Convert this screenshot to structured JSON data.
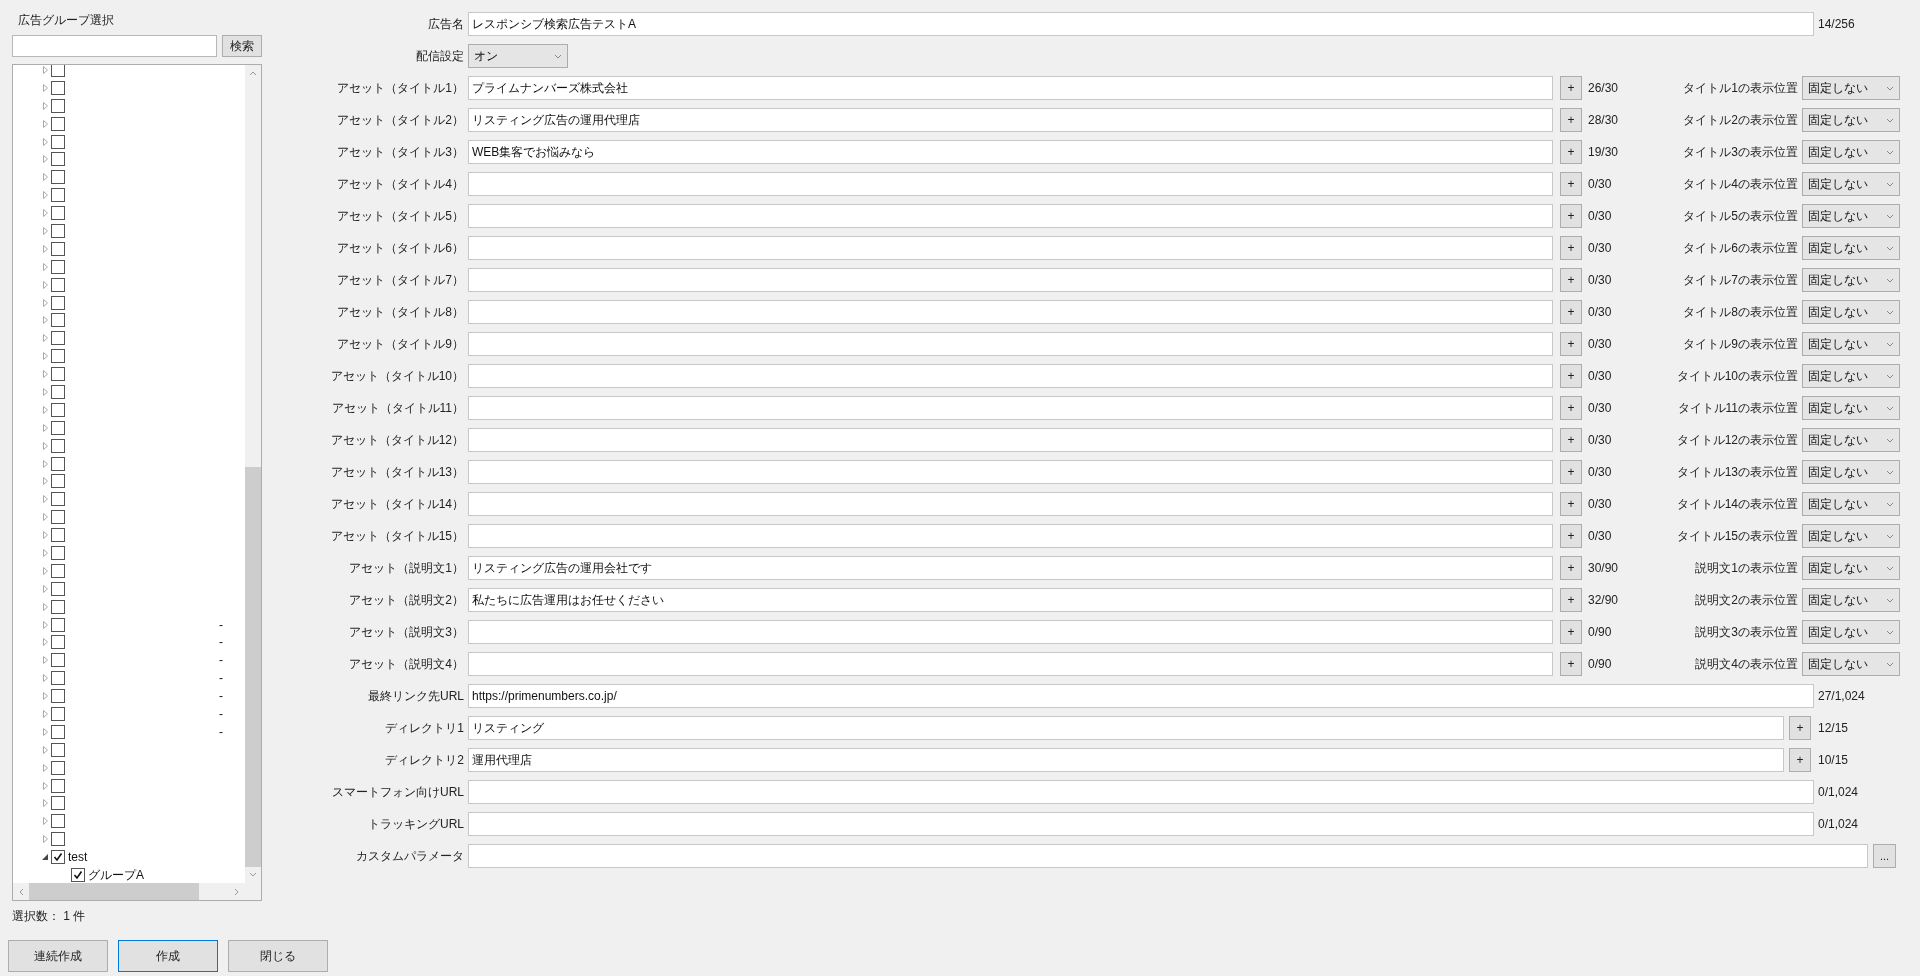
{
  "group_panel": {
    "title": "広告グループ選択",
    "search_button": "検索",
    "tree": [
      {
        "checked": false,
        "expanded": false
      },
      {
        "checked": false,
        "expanded": false
      },
      {
        "checked": false,
        "expanded": false
      },
      {
        "checked": false,
        "expanded": false
      },
      {
        "checked": false,
        "expanded": false
      },
      {
        "checked": false,
        "expanded": false
      },
      {
        "checked": false,
        "expanded": false
      },
      {
        "checked": false,
        "expanded": false
      },
      {
        "checked": false,
        "expanded": false
      },
      {
        "checked": false,
        "expanded": false
      },
      {
        "checked": false,
        "expanded": false
      },
      {
        "checked": false,
        "expanded": false
      },
      {
        "checked": false,
        "expanded": false
      },
      {
        "checked": false,
        "expanded": false
      },
      {
        "checked": false,
        "expanded": false
      },
      {
        "checked": false,
        "expanded": false
      },
      {
        "checked": false,
        "expanded": false
      },
      {
        "checked": false,
        "expanded": false
      },
      {
        "checked": false,
        "expanded": false
      },
      {
        "checked": false,
        "expanded": false
      },
      {
        "checked": false,
        "expanded": false
      },
      {
        "checked": false,
        "expanded": false
      },
      {
        "checked": false,
        "expanded": false
      },
      {
        "checked": false,
        "expanded": false
      },
      {
        "checked": false,
        "expanded": false
      },
      {
        "checked": false,
        "expanded": false
      },
      {
        "checked": false,
        "expanded": false
      },
      {
        "checked": false,
        "expanded": false
      },
      {
        "checked": false,
        "expanded": false
      },
      {
        "checked": false,
        "expanded": false
      },
      {
        "checked": false,
        "expanded": false
      },
      {
        "checked": false,
        "expanded": false,
        "note": "-"
      },
      {
        "checked": false,
        "expanded": false,
        "note": "-"
      },
      {
        "checked": false,
        "expanded": false,
        "note": "-"
      },
      {
        "checked": false,
        "expanded": false,
        "note": "-"
      },
      {
        "checked": false,
        "expanded": false,
        "note": "-"
      },
      {
        "checked": false,
        "expanded": false,
        "note": "-"
      },
      {
        "checked": false,
        "expanded": false,
        "note": "-"
      },
      {
        "checked": false,
        "expanded": false
      },
      {
        "checked": false,
        "expanded": false
      },
      {
        "checked": false,
        "expanded": false
      },
      {
        "checked": false,
        "expanded": false
      },
      {
        "checked": false,
        "expanded": false
      },
      {
        "checked": false,
        "expanded": false
      },
      {
        "label": "test",
        "checked": true,
        "expanded": true,
        "children": [
          {
            "label": "グループA",
            "checked": true
          }
        ]
      }
    ],
    "selection_count": "選択数： 1 件"
  },
  "form": [
    {
      "kind": "text",
      "label": "広告名",
      "value": "レスポンシブ検索広告テストA",
      "count": "14/256"
    },
    {
      "kind": "select",
      "label": "配信設定",
      "value": "オン"
    },
    {
      "kind": "asset",
      "label": "アセット（タイトル1）",
      "value": "プライムナンバーズ株式会社",
      "button": "+",
      "count": "26/30",
      "position_label": "タイトル1の表示位置",
      "position_value": "固定しない"
    },
    {
      "kind": "asset",
      "label": "アセット（タイトル2）",
      "value": "リスティング広告の運用代理店",
      "button": "+",
      "count": "28/30",
      "position_label": "タイトル2の表示位置",
      "position_value": "固定しない"
    },
    {
      "kind": "asset",
      "label": "アセット（タイトル3）",
      "value": "WEB集客でお悩みなら",
      "button": "+",
      "count": "19/30",
      "position_label": "タイトル3の表示位置",
      "position_value": "固定しない"
    },
    {
      "kind": "asset",
      "label": "アセット（タイトル4）",
      "button": "+",
      "count": "0/30",
      "position_label": "タイトル4の表示位置",
      "position_value": "固定しない"
    },
    {
      "kind": "asset",
      "label": "アセット（タイトル5）",
      "button": "+",
      "count": "0/30",
      "position_label": "タイトル5の表示位置",
      "position_value": "固定しない"
    },
    {
      "kind": "asset",
      "label": "アセット（タイトル6）",
      "button": "+",
      "count": "0/30",
      "position_label": "タイトル6の表示位置",
      "position_value": "固定しない"
    },
    {
      "kind": "asset",
      "label": "アセット（タイトル7）",
      "button": "+",
      "count": "0/30",
      "position_label": "タイトル7の表示位置",
      "position_value": "固定しない"
    },
    {
      "kind": "asset",
      "label": "アセット（タイトル8）",
      "button": "+",
      "count": "0/30",
      "position_label": "タイトル8の表示位置",
      "position_value": "固定しない"
    },
    {
      "kind": "asset",
      "label": "アセット（タイトル9）",
      "button": "+",
      "count": "0/30",
      "position_label": "タイトル9の表示位置",
      "position_value": "固定しない"
    },
    {
      "kind": "asset",
      "label": "アセット（タイトル10）",
      "button": "+",
      "count": "0/30",
      "position_label": "タイトル10の表示位置",
      "position_value": "固定しない"
    },
    {
      "kind": "asset",
      "label": "アセット（タイトル11）",
      "button": "+",
      "count": "0/30",
      "position_label": "タイトル11の表示位置",
      "position_value": "固定しない"
    },
    {
      "kind": "asset",
      "label": "アセット（タイトル12）",
      "button": "+",
      "count": "0/30",
      "position_label": "タイトル12の表示位置",
      "position_value": "固定しない"
    },
    {
      "kind": "asset",
      "label": "アセット（タイトル13）",
      "button": "+",
      "count": "0/30",
      "position_label": "タイトル13の表示位置",
      "position_value": "固定しない"
    },
    {
      "kind": "asset",
      "label": "アセット（タイトル14）",
      "button": "+",
      "count": "0/30",
      "position_label": "タイトル14の表示位置",
      "position_value": "固定しない"
    },
    {
      "kind": "asset",
      "label": "アセット（タイトル15）",
      "button": "+",
      "count": "0/30",
      "position_label": "タイトル15の表示位置",
      "position_value": "固定しない"
    },
    {
      "kind": "asset",
      "label": "アセット（説明文1）",
      "value": "リスティング広告の運用会社です",
      "button": "+",
      "count": "30/90",
      "position_label": "説明文1の表示位置",
      "position_value": "固定しない"
    },
    {
      "kind": "asset",
      "label": "アセット（説明文2）",
      "value": "私たちに広告運用はお任せください",
      "button": "+",
      "count": "32/90",
      "position_label": "説明文2の表示位置",
      "position_value": "固定しない"
    },
    {
      "kind": "asset",
      "label": "アセット（説明文3）",
      "button": "+",
      "count": "0/90",
      "position_label": "説明文3の表示位置",
      "position_value": "固定しない"
    },
    {
      "kind": "asset",
      "label": "アセット（説明文4）",
      "button": "+",
      "count": "0/90",
      "position_label": "説明文4の表示位置",
      "position_value": "固定しない"
    },
    {
      "kind": "text",
      "label": "最終リンク先URL",
      "value": "https://primenumbers.co.jp/",
      "count": "27/1,024"
    },
    {
      "kind": "directory",
      "label": "ディレクトリ1",
      "value": "リスティング",
      "button": "+",
      "count": "12/15"
    },
    {
      "kind": "directory",
      "label": "ディレクトリ2",
      "value": "運用代理店",
      "button": "+",
      "count": "10/15"
    },
    {
      "kind": "text",
      "label": "スマートフォン向けURL",
      "count": "0/1,024"
    },
    {
      "kind": "text",
      "label": "トラッキングURL",
      "count": "0/1,024"
    },
    {
      "kind": "param",
      "label": "カスタムパラメータ",
      "button": "..."
    }
  ],
  "buttons": [
    {
      "label": "連続作成",
      "default": false
    },
    {
      "label": "作成",
      "default": true
    },
    {
      "label": "閉じる",
      "default": false
    }
  ]
}
